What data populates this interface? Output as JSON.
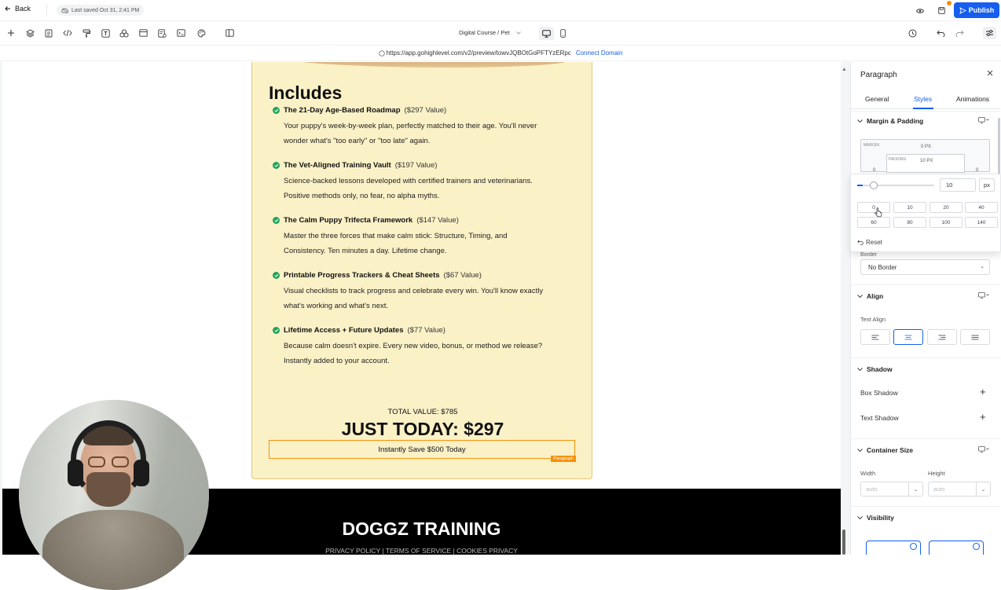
{
  "topbar": {
    "back_label": "Back",
    "last_saved": "Last saved Oct 31, 2:41 PM",
    "publish_label": "Publish"
  },
  "toolbar": {
    "page_name": "Digital Course / Pet"
  },
  "urlbar": {
    "url": "https://app.gohighlevel.com/v2/preview/towvJQBOtGoPFTYzERpc",
    "connect_domain": "Connect Domain"
  },
  "card": {
    "heading": "Includes",
    "items": [
      {
        "title": "The 21-Day Age-Based Roadmap",
        "value": "($297 Value)",
        "desc1": "Your puppy's week-by-week plan, perfectly matched to their age. You'll never",
        "desc2": "wonder what's \"too early\" or \"too late\" again."
      },
      {
        "title": "The Vet-Aligned Training Vault",
        "value": "($197 Value)",
        "desc1": "Science-backed lessons developed with certified trainers and veterinarians.",
        "desc2": "Positive methods only, no fear, no alpha myths."
      },
      {
        "title": "The Calm Puppy Trifecta Framework",
        "value": "($147 Value)",
        "desc1": "Master the three forces that make calm stick: Structure, Timing, and",
        "desc2": "Consistency. Ten minutes a day. Lifetime change."
      },
      {
        "title": "Printable Progress Trackers & Cheat Sheets",
        "value": "($67 Value)",
        "desc1": "Visual checklists to track progress and celebrate every win. You'll know exactly",
        "desc2": "what's working and what's next."
      },
      {
        "title": "Lifetime Access + Future Updates",
        "value": "($77 Value)",
        "desc1": "Because calm doesn't expire. Every new video, bonus, or method we release?",
        "desc2": "Instantly added to your account."
      }
    ],
    "total_value": "TOTAL VALUE: $785",
    "just_today": "JUST TODAY: $297",
    "save_text": "Instantly Save $500 Today",
    "selected_tag": "Paragraph"
  },
  "footer": {
    "brand": "DOGGZ TRAINING",
    "links": "PRIVACY POLICY | TERMS OF SERVICE | COOKIES PRIVACY"
  },
  "panel": {
    "title": "Paragraph",
    "tabs": [
      "General",
      "Styles",
      "Animations"
    ],
    "active_tab": "Styles",
    "margin_padding": {
      "section_title": "Margin & Padding",
      "margin_label": "MARGIN",
      "margin_top": "0 PX",
      "padding_label": "PADDING",
      "padding_top": "10 PX",
      "side_left": "0",
      "side_right": "0"
    },
    "popover": {
      "value": "10",
      "unit": "px",
      "slider_fraction": 0.07,
      "presets": [
        "0",
        "10",
        "20",
        "40",
        "60",
        "80",
        "100",
        "140"
      ],
      "reset_label": "Reset"
    },
    "border": {
      "label": "Border",
      "value": "No Border"
    },
    "align": {
      "section_title": "Align",
      "text_align_label": "Text Align",
      "active": "center"
    },
    "shadow": {
      "section_title": "Shadow",
      "box_shadow": "Box Shadow",
      "text_shadow": "Text Shadow"
    },
    "container_size": {
      "section_title": "Container Size",
      "width_label": "Width",
      "height_label": "Height",
      "width_value": "auto",
      "height_value": "auto"
    },
    "visibility": {
      "section_title": "Visibility"
    }
  },
  "colors": {
    "accent": "#155eef",
    "selection": "#f79009",
    "card_bg": "#fbf1c7",
    "check": "#22a35a",
    "footer_bg": "#000000"
  },
  "icons": [
    "back-arrow-icon",
    "cloud-off-icon",
    "eye-icon",
    "save-icon",
    "send-icon",
    "plus-icon",
    "layers-icon",
    "page-icon",
    "code-icon",
    "paint-roller-icon",
    "text-icon",
    "shapes-icon",
    "layout-icon",
    "form-icon",
    "terminal-icon",
    "palette-icon",
    "columns-icon",
    "desktop-icon",
    "mobile-icon",
    "history-icon",
    "undo-icon",
    "redo-icon",
    "settings-sliders-icon",
    "globe-icon",
    "check-circle-icon",
    "close-icon"
  ]
}
